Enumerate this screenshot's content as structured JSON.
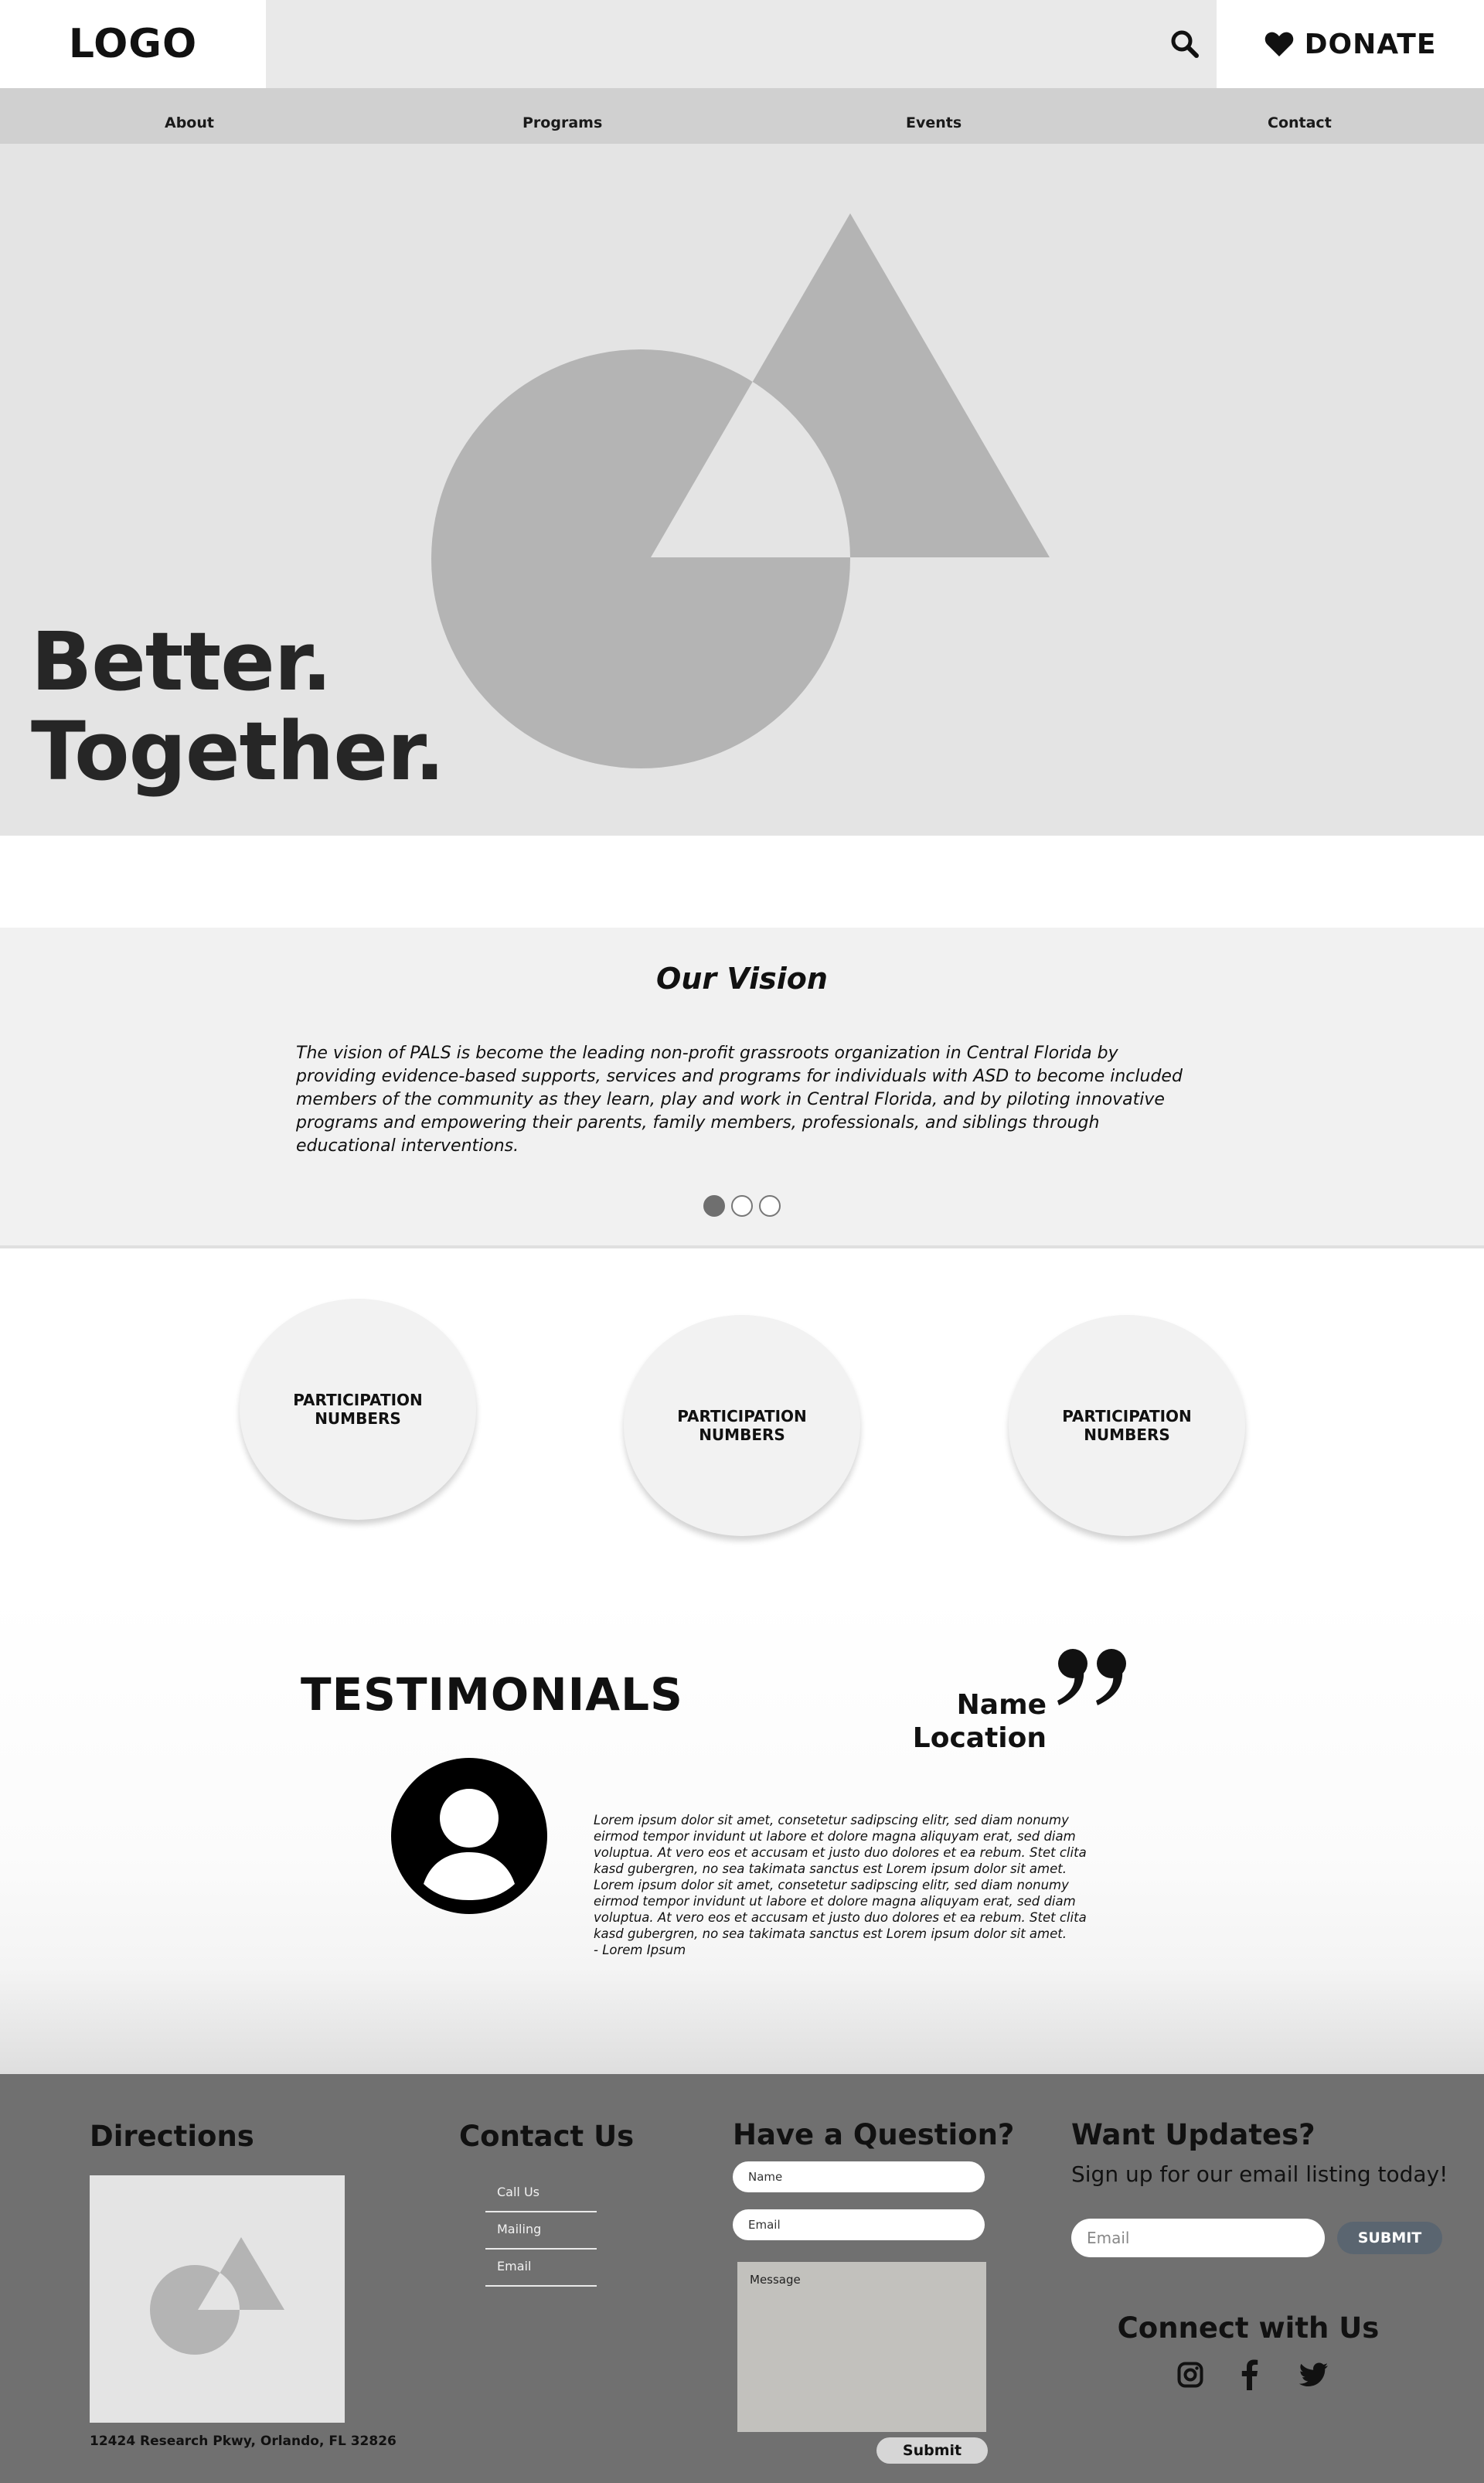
{
  "header": {
    "logo": "LOGO",
    "search_icon": "search-icon",
    "donate": {
      "icon": "heart-icon",
      "label": "DONATE"
    }
  },
  "nav": {
    "items": [
      {
        "label": "About"
      },
      {
        "label": "Programs"
      },
      {
        "label": "Events"
      },
      {
        "label": "Contact"
      }
    ]
  },
  "hero": {
    "title_line1": "Better.",
    "title_line2": "Together.",
    "image": "shapes-placeholder-image"
  },
  "vision": {
    "title": "Our Vision",
    "text": "The vision of PALS is become the leading non-profit grassroots organization in Central Florida by providing evidence-based supports, services and programs for individuals with ASD to become included members of the community as they learn, play and work in Central Florida, and by piloting innovative programs and empowering their parents, family members, professionals, and siblings through educational interventions.",
    "carousel": {
      "slides": 3,
      "active": 1
    }
  },
  "stats": [
    {
      "line1": "PARTICIPATION",
      "line2": "NUMBERS"
    },
    {
      "line1": "PARTICIPATION",
      "line2": "NUMBERS"
    },
    {
      "line1": "PARTICIPATION",
      "line2": "NUMBERS"
    }
  ],
  "testimonials": {
    "title": "TESTIMONIALS",
    "name": "Name",
    "location": "Location",
    "avatar_icon": "user-avatar-icon",
    "quote_icon": "quote-icon",
    "body": "Lorem ipsum dolor sit amet, consetetur sadipscing elitr, sed diam nonumy eirmod tempor invidunt ut labore et dolore magna aliquyam erat, sed diam voluptua. At vero eos et accusam et justo duo dolores et ea rebum. Stet clita kasd gubergren, no sea takimata sanctus est Lorem ipsum dolor sit amet. Lorem ipsum dolor sit amet, consetetur sadipscing elitr, sed diam nonumy eirmod tempor invidunt ut labore et dolore magna aliquyam erat, sed diam voluptua. At vero eos et accusam et justo duo dolores et ea rebum. Stet clita kasd gubergren, no sea takimata sanctus est Lorem ipsum dolor sit amet.",
    "attribution": "- Lorem Ipsum"
  },
  "footer": {
    "directions": {
      "title": "Directions",
      "address": "12424 Research Pkwy, Orlando, FL 32826"
    },
    "contact": {
      "title": "Contact Us",
      "links": [
        {
          "label": "Call Us"
        },
        {
          "label": "Mailing"
        },
        {
          "label": "Email"
        }
      ]
    },
    "question": {
      "title": "Have a Question?",
      "name_placeholder": "Name",
      "email_placeholder": "Email",
      "message_placeholder": "Message",
      "submit": "Submit"
    },
    "updates": {
      "title": "Want Updates?",
      "subtitle": "Sign up for our email listing today!",
      "email_placeholder": "Email",
      "submit": "SUBMIT"
    },
    "connect": {
      "title": "Connect with Us",
      "icons": [
        "instagram-icon",
        "facebook-icon",
        "twitter-icon"
      ]
    }
  },
  "colors": {
    "header_bg": "#e9e9e9",
    "nav_bg": "#d0d0d0",
    "hero_bg": "#e4e4e4",
    "shape_gray": "#b4b4b4",
    "vision_bg": "#f1f1f1",
    "footer_bg": "#707070",
    "submit_blue": "#5a6570"
  }
}
